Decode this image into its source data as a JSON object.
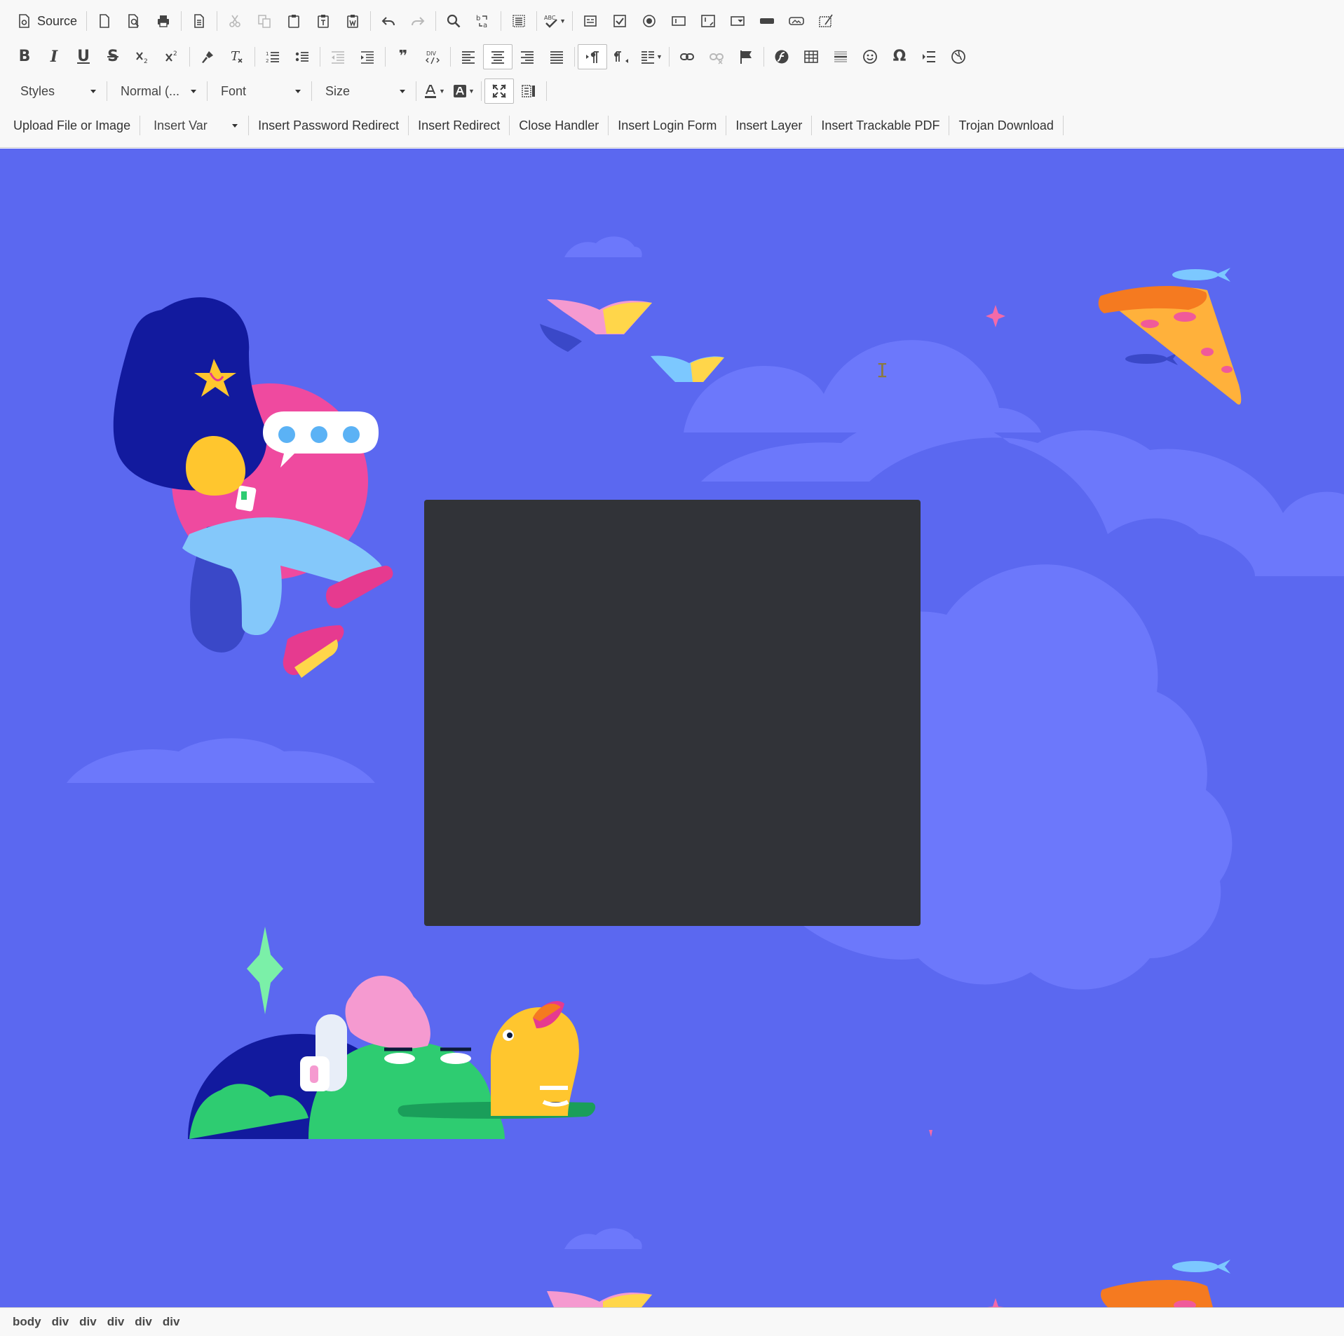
{
  "toolbar": {
    "source_label": "Source",
    "styles_label": "Styles",
    "format_label": "Normal (...",
    "font_label": "Font",
    "size_label": "Size",
    "bold_glyph": "B",
    "italic_glyph": "I",
    "underline_glyph": "U",
    "strike_glyph": "S",
    "omega_glyph": "Ω",
    "blockquote_glyph": "❞"
  },
  "custom_buttons": {
    "upload": "Upload File or Image",
    "insert_var": "Insert Var",
    "insert_password_redirect": "Insert Password Redirect",
    "insert_redirect": "Insert Redirect",
    "close_handler": "Close Handler",
    "insert_login_form": "Insert Login Form",
    "insert_layer": "Insert Layer",
    "insert_trackable_pdf": "Insert Trackable PDF",
    "trojan_download": "Trojan Download"
  },
  "editor": {
    "background_color": "#5b68f0",
    "panel_color": "#313338",
    "cloud_color": "#6c78fb"
  },
  "statusbar": {
    "path": [
      "body",
      "div",
      "div",
      "div",
      "div",
      "div"
    ]
  }
}
